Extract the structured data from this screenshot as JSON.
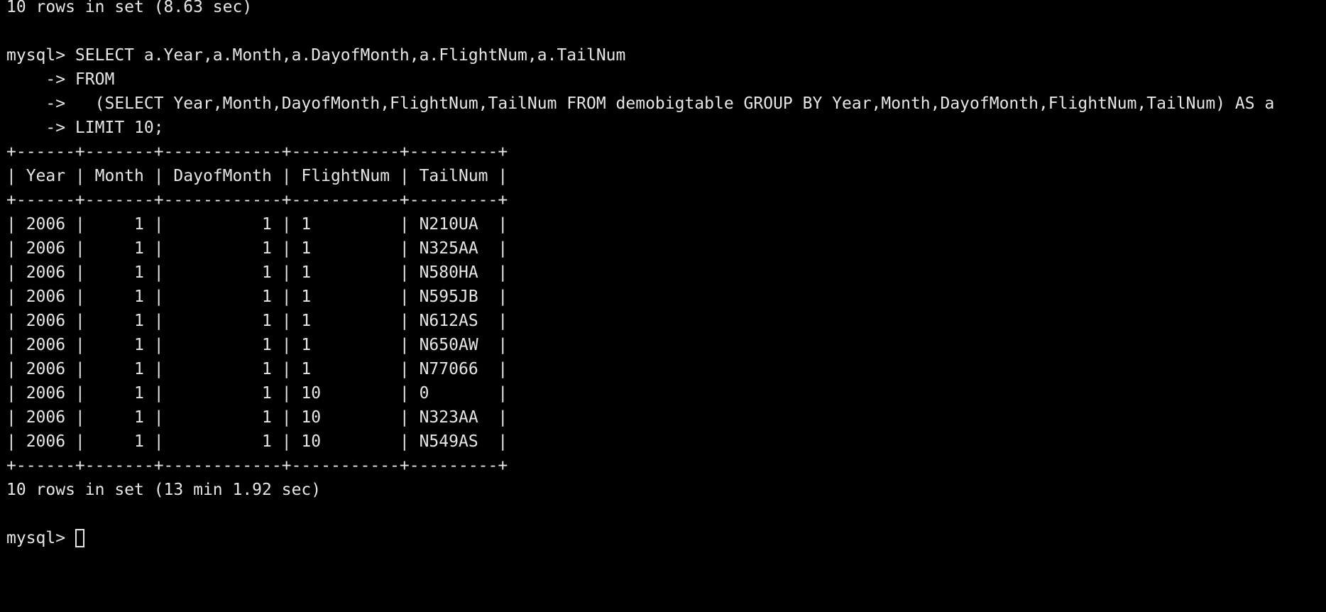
{
  "colors": {
    "background": "#000000",
    "foreground": "#e6e6e6"
  },
  "terminal": {
    "lines": [
      "10 rows in set (8.63 sec)",
      "",
      "mysql> SELECT a.Year,a.Month,a.DayofMonth,a.FlightNum,a.TailNum",
      "    -> FROM",
      "    ->   (SELECT Year,Month,DayofMonth,FlightNum,TailNum FROM demobigtable GROUP BY Year,Month,DayofMonth,FlightNum,TailNum) AS a",
      "    -> LIMIT 10;",
      "+------+-------+------------+-----------+---------+",
      "| Year | Month | DayofMonth | FlightNum | TailNum |",
      "+------+-------+------------+-----------+---------+",
      "| 2006 |     1 |          1 | 1         | N210UA  |",
      "| 2006 |     1 |          1 | 1         | N325AA  |",
      "| 2006 |     1 |          1 | 1         | N580HA  |",
      "| 2006 |     1 |          1 | 1         | N595JB  |",
      "| 2006 |     1 |          1 | 1         | N612AS  |",
      "| 2006 |     1 |          1 | 1         | N650AW  |",
      "| 2006 |     1 |          1 | 1         | N77066  |",
      "| 2006 |     1 |          1 | 10        | 0       |",
      "| 2006 |     1 |          1 | 10        | N323AA  |",
      "| 2006 |     1 |          1 | 10        | N549AS  |",
      "+------+-------+------------+-----------+---------+",
      "10 rows in set (13 min 1.92 sec)",
      ""
    ],
    "prompt": "mysql> "
  }
}
